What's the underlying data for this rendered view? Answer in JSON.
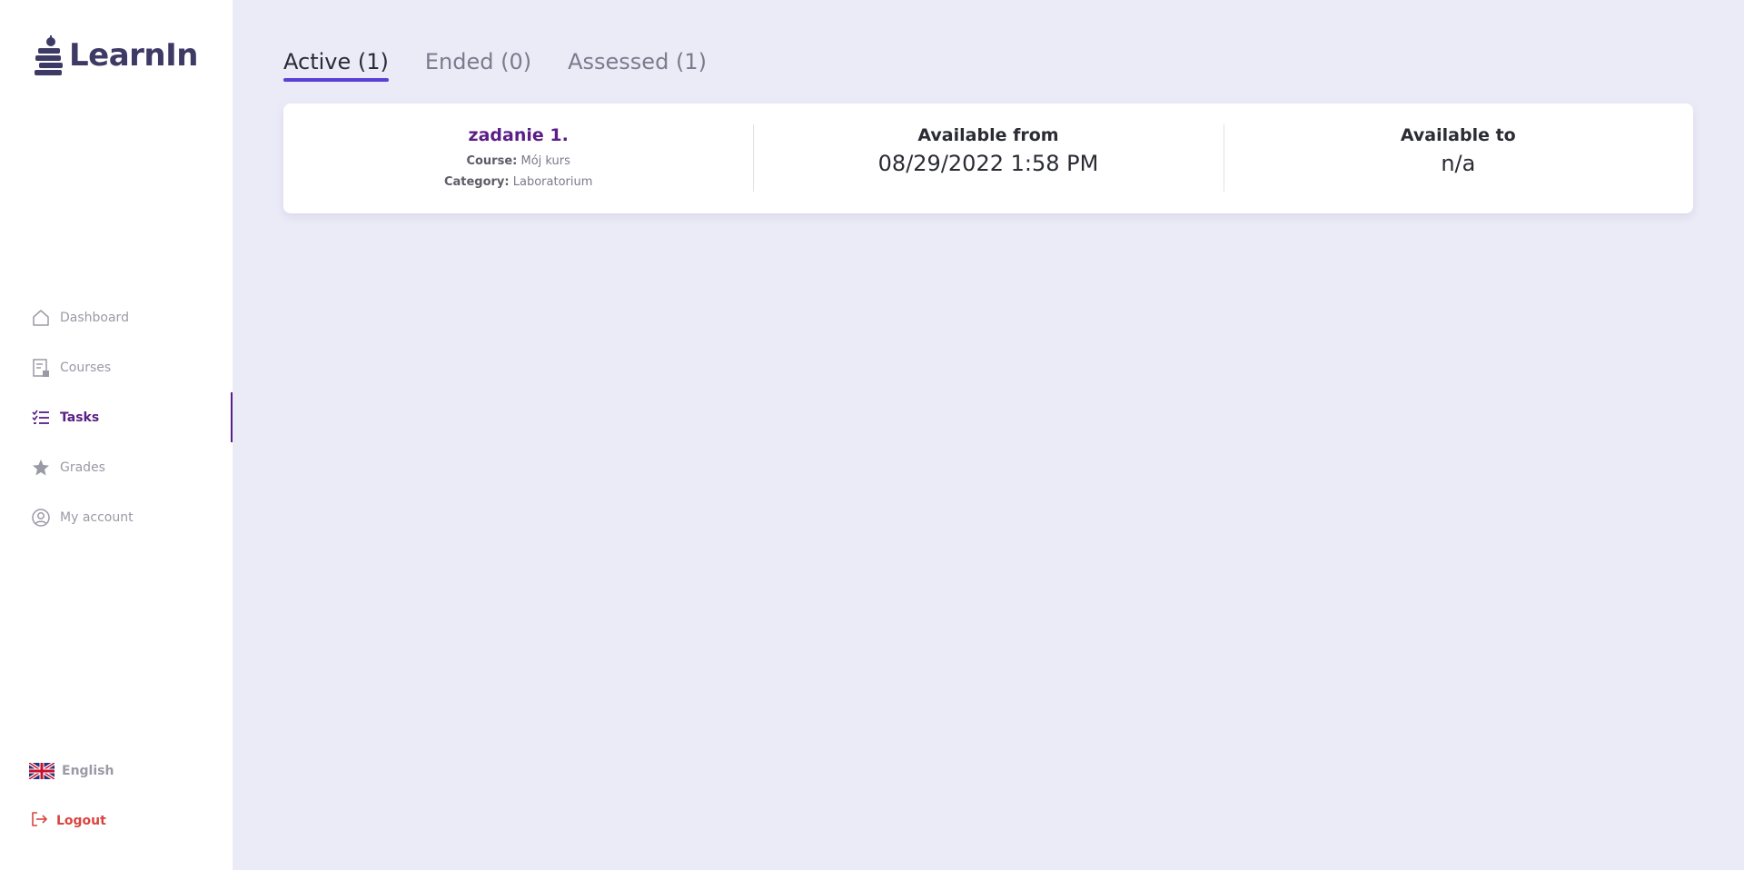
{
  "app": {
    "logo_text": "LearnIn"
  },
  "sidebar": {
    "items": [
      {
        "label": "Dashboard",
        "icon": "home-icon"
      },
      {
        "label": "Courses",
        "icon": "courses-icon"
      },
      {
        "label": "Tasks",
        "icon": "tasks-icon",
        "active": true
      },
      {
        "label": "Grades",
        "icon": "star-icon"
      },
      {
        "label": "My account",
        "icon": "user-circle-icon"
      }
    ],
    "language": "English",
    "logout": "Logout"
  },
  "tabs": [
    {
      "label": "Active (1)",
      "active": true
    },
    {
      "label": "Ended (0)"
    },
    {
      "label": "Assessed (1)"
    }
  ],
  "task": {
    "title": "zadanie 1.",
    "course_label": "Course:",
    "course_value": "Mój kurs",
    "category_label": "Category:",
    "category_value": "Laboratorium",
    "available_from_label": "Available from",
    "available_from_value": "08/29/2022 1:58 PM",
    "available_to_label": "Available to",
    "available_to_value": "n/a"
  },
  "colors": {
    "accent": "#5b1d86",
    "tab_underline": "#5b3fd6",
    "logout": "#d9443f",
    "background": "#ebebf8"
  }
}
